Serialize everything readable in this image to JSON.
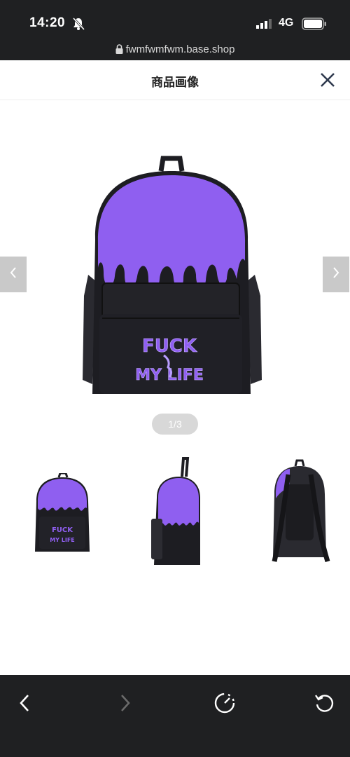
{
  "status": {
    "time": "14:20",
    "network": "4G"
  },
  "browser": {
    "url": "fwmfwmfwm.base.shop"
  },
  "header": {
    "title": "商品画像"
  },
  "gallery": {
    "pager": "1/3",
    "thumbnail_count": 3,
    "main_artwork_text": [
      "FUCK",
      "MY LIFE"
    ]
  },
  "colors": {
    "bag_purple": "#8f5ff0",
    "bag_black": "#1d1d22",
    "bar_dark": "#1f2022"
  },
  "icons": [
    "mute-bell-icon",
    "signal-icon",
    "battery-icon",
    "lock-icon",
    "close-icon",
    "chevron-left-icon",
    "chevron-right-icon",
    "back-icon",
    "forward-icon",
    "speed-icon",
    "reload-icon"
  ]
}
